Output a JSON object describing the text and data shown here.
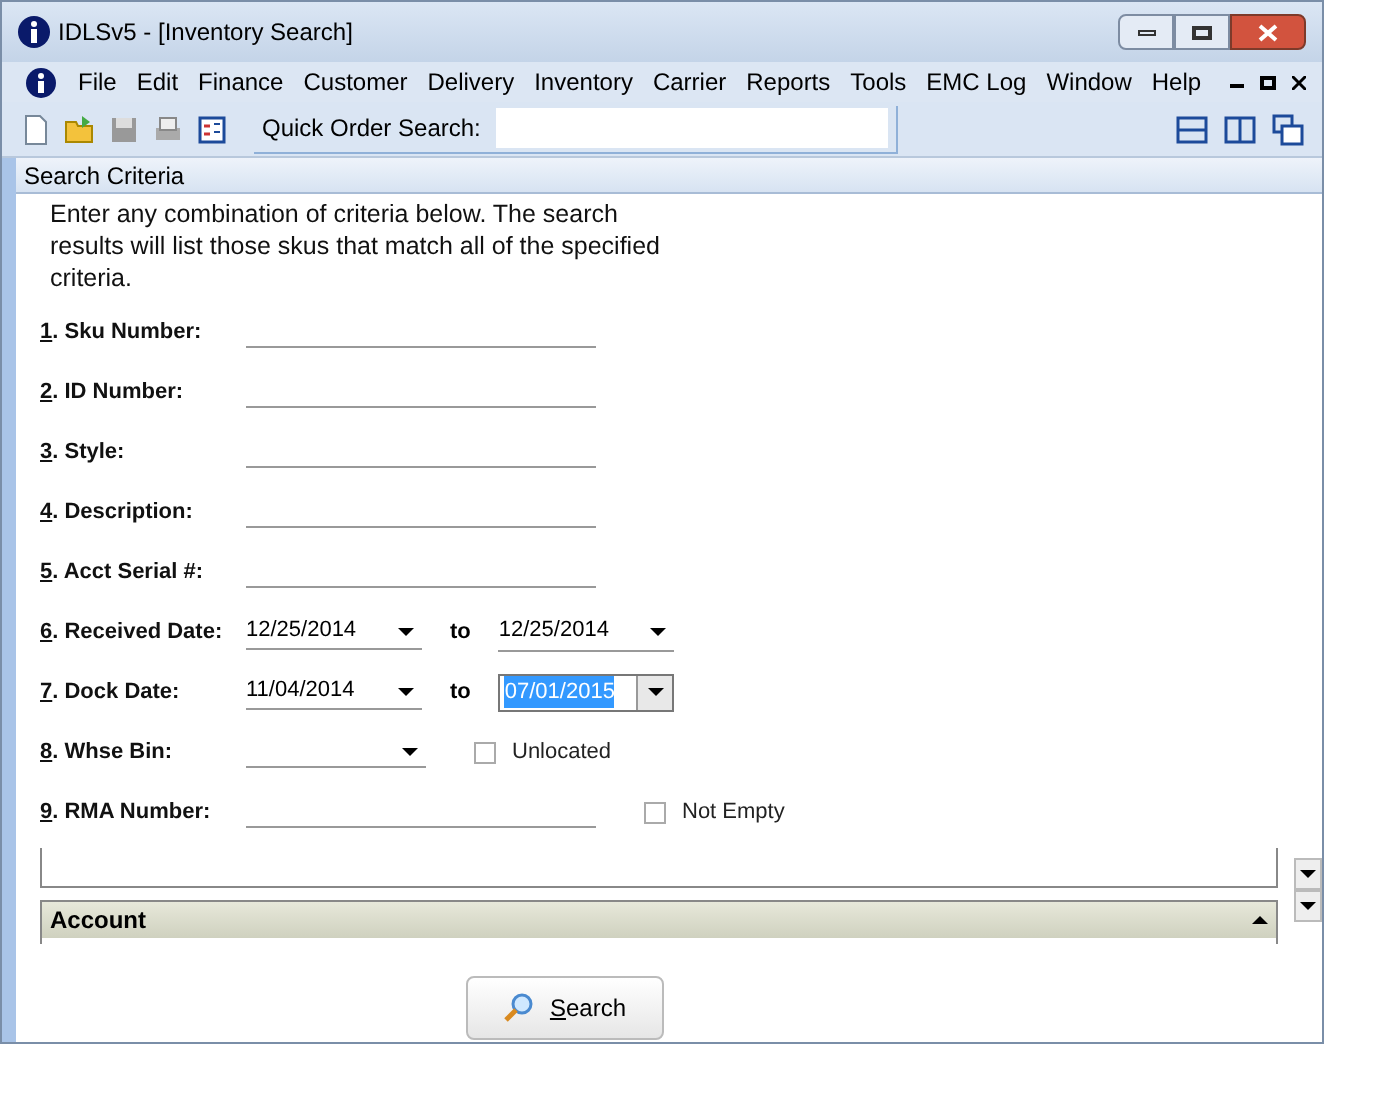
{
  "window": {
    "title": "IDLSv5 - [Inventory Search]"
  },
  "menu": [
    "File",
    "Edit",
    "Finance",
    "Customer",
    "Delivery",
    "Inventory",
    "Carrier",
    "Reports",
    "Tools",
    "EMC Log",
    "Window",
    "Help"
  ],
  "toolbar": {
    "quick_search_label": "Quick Order Search:"
  },
  "panel": {
    "title": "Search Criteria",
    "intro": "Enter any combination of criteria below.  The search results will list those skus that match all of the specified criteria."
  },
  "fields": [
    {
      "kind": "text",
      "label": "1. Sku Number:"
    },
    {
      "kind": "text",
      "label": "2. ID Number:"
    },
    {
      "kind": "text",
      "label": "3. Style:"
    },
    {
      "kind": "text",
      "label": "4. Description:"
    },
    {
      "kind": "text",
      "label": "5. Acct Serial #:"
    },
    {
      "kind": "daterange",
      "label": "6. Received Date:",
      "from": "12/25/2014",
      "to_label": "to",
      "to": "12/25/2014",
      "to_selected": false
    },
    {
      "kind": "daterange",
      "label": "7. Dock Date:",
      "from": "11/04/2014",
      "to_label": "to",
      "to": "07/01/2015",
      "to_selected": true
    },
    {
      "kind": "select",
      "label": "8. Whse Bin:",
      "checkbox": {
        "label": "Unlocated",
        "checked": false
      }
    },
    {
      "kind": "text",
      "label": "9. RMA Number:",
      "checkbox": {
        "label": "Not Empty",
        "checked": false
      }
    }
  ],
  "account": {
    "title": "Account",
    "expanded": true
  },
  "search_button": "Search"
}
